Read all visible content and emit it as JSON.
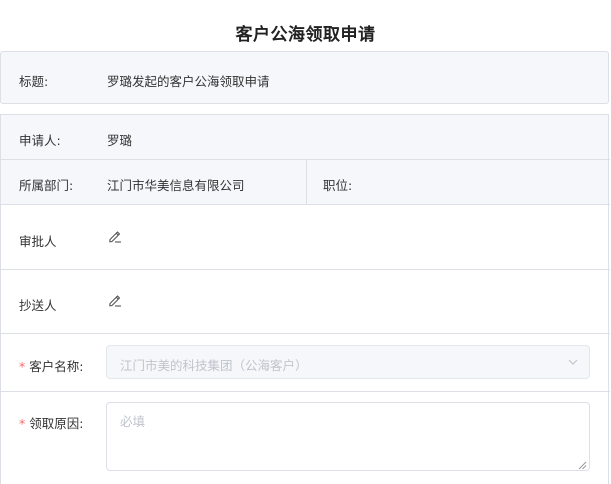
{
  "page_title": "客户公海领取申请",
  "subject": {
    "label": "标题:",
    "value": "罗璐发起的客户公海领取申请"
  },
  "applicant": {
    "label": "申请人:",
    "value": "罗璐"
  },
  "department": {
    "label": "所属部门:",
    "value": "江门市华美信息有限公司"
  },
  "position": {
    "label": "职位:",
    "value": ""
  },
  "approver": {
    "label": "审批人",
    "icon": "edit-icon"
  },
  "cc": {
    "label": "抄送人",
    "icon": "edit-icon"
  },
  "customer": {
    "required_mark": "*",
    "label": "客户名称:",
    "selected": "江门市美的科技集团（公海客户）",
    "icon": "chevron-down-icon"
  },
  "reason": {
    "required_mark": "*",
    "label": "领取原因:",
    "placeholder": "必填"
  },
  "colors": {
    "border": "#dcdfe6",
    "gray_bg": "#f5f7fa",
    "required": "#f56c6c",
    "placeholder": "#c0c4cc"
  }
}
